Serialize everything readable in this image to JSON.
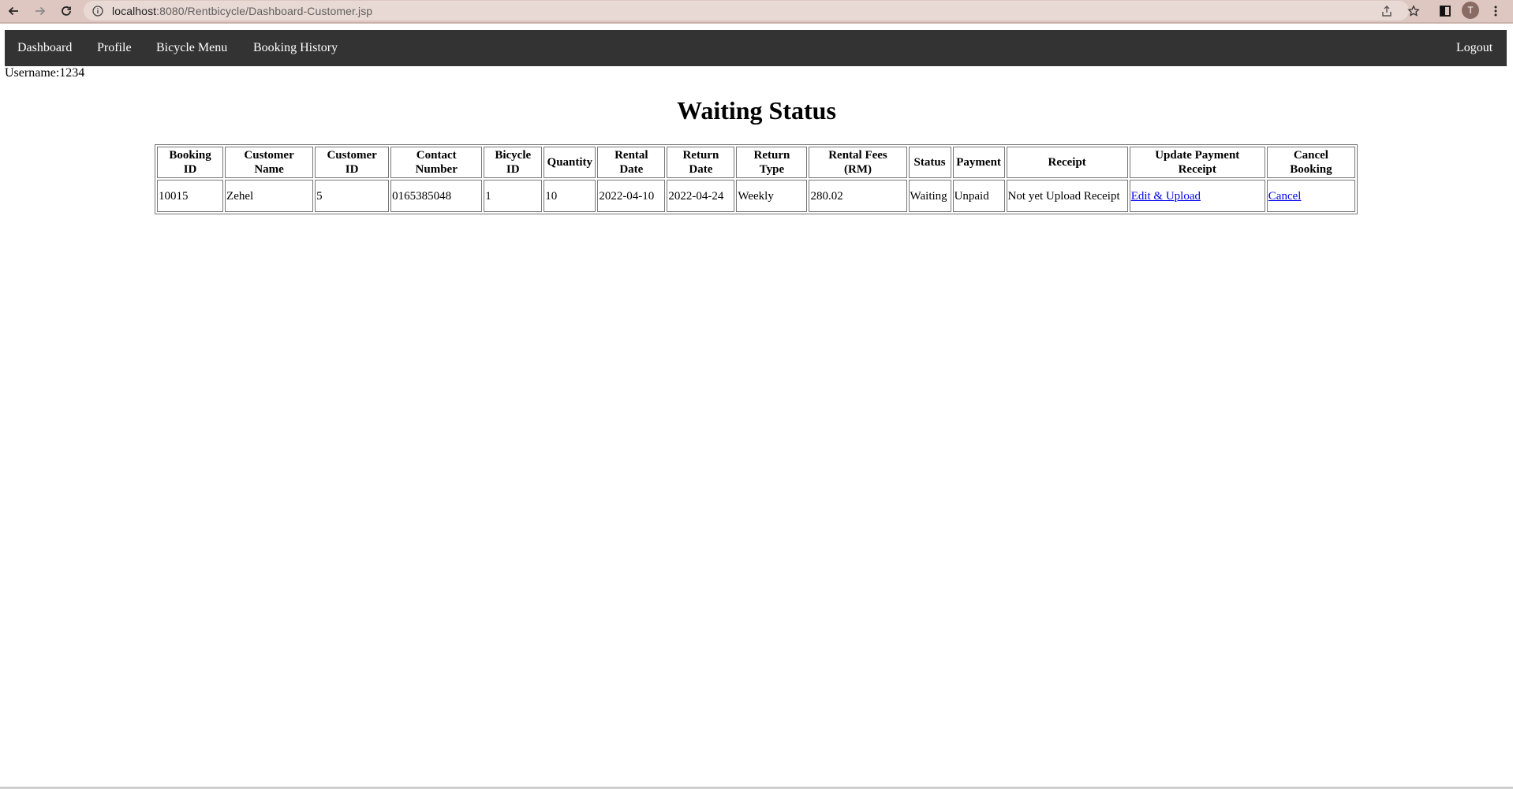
{
  "browser": {
    "url_host": "localhost",
    "url_rest": ":8080/Rentbicycle/Dashboard-Customer.jsp",
    "profile_initial": "T"
  },
  "nav": {
    "dashboard": "Dashboard",
    "profile": "Profile",
    "bicycle_menu": "Bicycle Menu",
    "booking_history": "Booking History",
    "logout": "Logout"
  },
  "user": {
    "username_label": "Username:1234"
  },
  "page": {
    "title": "Waiting Status"
  },
  "table": {
    "headers": [
      [
        "Booking",
        "ID"
      ],
      [
        "Customer",
        "Name"
      ],
      [
        "Customer",
        "ID"
      ],
      [
        "Contact",
        "Number"
      ],
      [
        "Bicycle",
        "ID"
      ],
      [
        "Quantity"
      ],
      [
        "Rental",
        "Date"
      ],
      [
        "Return",
        "Date"
      ],
      [
        "Return",
        "Type"
      ],
      [
        "Rental Fees",
        "(RM)"
      ],
      [
        "Status"
      ],
      [
        "Payment"
      ],
      [
        "Receipt"
      ],
      [
        "Update Payment",
        "Receipt"
      ],
      [
        "Cancel",
        "Booking"
      ]
    ],
    "rows": [
      {
        "booking_id": "10015",
        "customer_name": "Zehel",
        "customer_id": "5",
        "contact_number": "0165385048",
        "bicycle_id": "1",
        "quantity": "10",
        "rental_date": "2022-04-10",
        "return_date": "2022-04-24",
        "return_type": "Weekly",
        "rental_fees": "280.02",
        "status": "Waiting",
        "payment": "Unpaid",
        "receipt": "Not yet Upload Receipt",
        "update_link": "Edit & Upload",
        "cancel_link": "Cancel"
      }
    ]
  }
}
